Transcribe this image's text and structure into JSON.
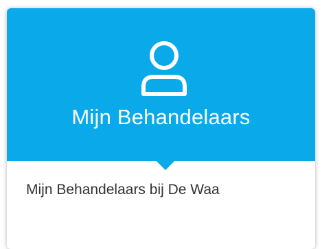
{
  "card": {
    "icon": "user-icon",
    "title": "Mijn Behandelaars",
    "description": "Mijn Behandelaars bij De Waa"
  },
  "colors": {
    "header_background": "#0aa9ea",
    "title_text": "#ffffff",
    "description_text": "#333333"
  }
}
